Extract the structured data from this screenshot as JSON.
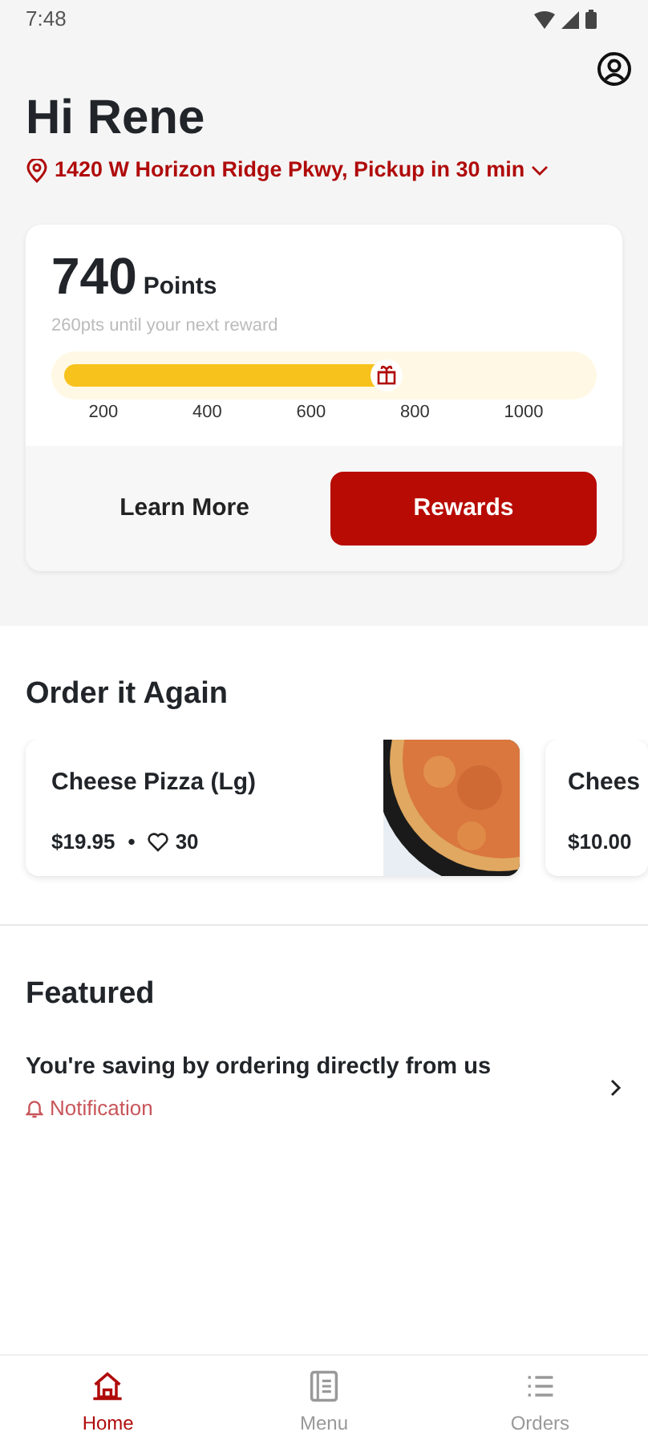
{
  "status_bar": {
    "time": "7:48"
  },
  "greeting": "Hi Rene",
  "location": "1420 W Horizon Ridge Pkwy, Pickup in 30 min",
  "rewards": {
    "points": "740",
    "points_label": "Points",
    "subtitle": "260pts until your next reward",
    "level": 0.62,
    "ticks": [
      "200",
      "400",
      "600",
      "800",
      "1000"
    ],
    "buttons": [
      {
        "label": "Learn More",
        "kind": "plain"
      },
      {
        "label": "Rewards",
        "kind": "primary"
      }
    ]
  },
  "order_again": {
    "title": "Order it Again",
    "items": [
      {
        "name": "Cheese Pizza  (Lg)",
        "price": "$19.95",
        "separator": "•",
        "likes": "30",
        "kind": "picture"
      },
      {
        "name": "Chees",
        "price": "$10.00"
      }
    ]
  },
  "featured": {
    "title": "Featured",
    "items": [
      {
        "title": "You're saving by ordering directly from us",
        "tag": "Notification"
      }
    ]
  },
  "nav": [
    {
      "label": "Home",
      "selected": true
    },
    {
      "label": "Menu",
      "selected": false
    },
    {
      "label": "Orders",
      "selected": false
    }
  ]
}
